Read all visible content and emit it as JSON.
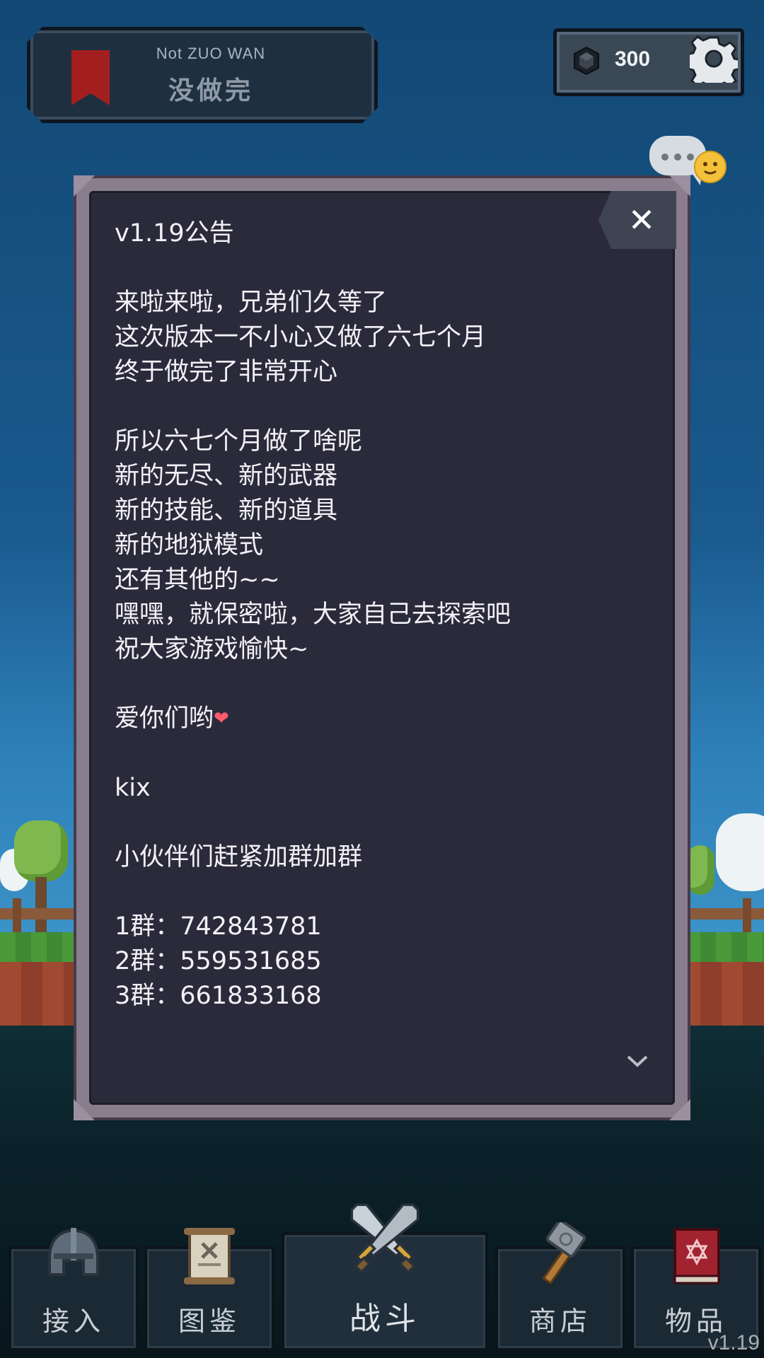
{
  "header": {
    "subtitle": "Not ZUO WAN",
    "title": "没做完"
  },
  "currency": {
    "amount": "300",
    "icon": "gem-icon"
  },
  "notice": {
    "lines": [
      "v1.19公告",
      "",
      "来啦来啦，兄弟们久等了",
      "这次版本一不小心又做了六七个月",
      "终于做完了非常开心",
      "",
      "所以六七个月做了啥呢",
      "新的无尽、新的武器",
      "新的技能、新的道具",
      "新的地狱模式",
      "还有其他的~~",
      "嘿嘿，就保密啦，大家自己去探索吧",
      "祝大家游戏愉快~",
      "",
      "爱你们哟",
      "",
      "kix",
      "",
      "小伙伴们赶紧加群加群",
      "",
      "1群：742843781",
      "2群：559531685",
      "3群：661833168"
    ],
    "heart_icon": "heart-icon",
    "close_symbol": "✕"
  },
  "nav": {
    "items": [
      {
        "label": "接入",
        "icon": "helmet-icon"
      },
      {
        "label": "图鉴",
        "icon": "scroll-icon"
      },
      {
        "label": "战斗",
        "icon": "crossed-swords-icon",
        "active": true
      },
      {
        "label": "商店",
        "icon": "hammer-icon"
      },
      {
        "label": "物品",
        "icon": "spellbook-icon"
      }
    ]
  },
  "version": "v1.19",
  "colors": {
    "sky": "#134a78",
    "dialog_bg": "#2b2a3b",
    "dialog_frame": "#8a7d8e",
    "accent_red": "#a31f1f",
    "heart": "#ff5a6e"
  }
}
